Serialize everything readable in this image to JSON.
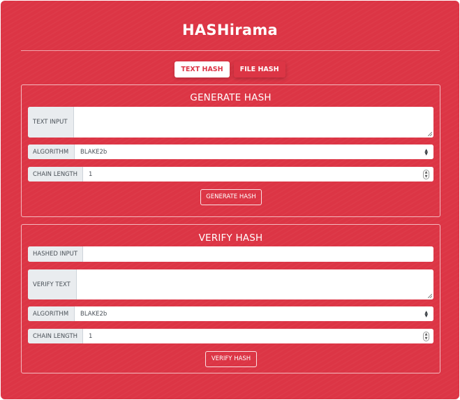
{
  "app": {
    "title": "HASHirama"
  },
  "tabs": [
    {
      "label": "TEXT HASH",
      "active": true
    },
    {
      "label": "FILE HASH",
      "active": false
    }
  ],
  "generate": {
    "title": "GENERATE HASH",
    "text_input_label": "TEXT INPUT",
    "text_input_value": "",
    "algorithm_label": "ALGORITHM",
    "algorithm_value": "BLAKE2b",
    "chain_length_label": "CHAIN LENGTH",
    "chain_length_value": "1",
    "button_label": "GENERATE HASH"
  },
  "verify": {
    "title": "VERIFY HASH",
    "hashed_input_label": "HASHED INPUT",
    "hashed_input_value": "",
    "verify_text_label": "VERIFY TEXT",
    "verify_text_value": "",
    "algorithm_label": "ALGORITHM",
    "algorithm_value": "BLAKE2b",
    "chain_length_label": "CHAIN LENGTH",
    "chain_length_value": "1",
    "button_label": "VERIFY HASH"
  },
  "colors": {
    "brand": "#dc3545",
    "addon_bg": "#e9ecef",
    "text": "#495057"
  },
  "icons": {
    "select": "select-arrows-icon",
    "spinner": "number-spinner-icon",
    "resize": "resize-grip-icon"
  }
}
